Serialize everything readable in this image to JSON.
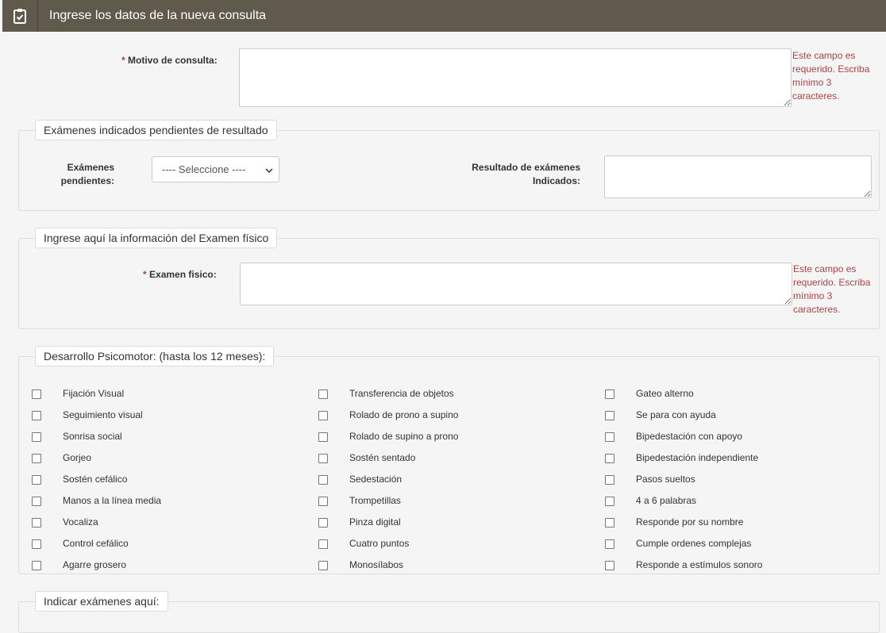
{
  "header": {
    "title": "Ingrese los datos de la nueva consulta"
  },
  "motivo": {
    "required_mark": "*",
    "label": "Motivo de consulta:",
    "error": [
      "Este campo es",
      "requerido. Escriba",
      "mínimo 3",
      "caracteres."
    ]
  },
  "examenes": {
    "legend": "Exámenes indicados pendientes de resultado",
    "pendientes_label": [
      "Exámenes",
      "pendientes:"
    ],
    "select_value": "---- Seleccione ----",
    "resultado_label": [
      "Resultado de exámenes",
      "Indicados:"
    ]
  },
  "fisico": {
    "legend": "Ingrese aquí la información del Examen físico",
    "required_mark": "*",
    "label": "Examen fisico:",
    "error": [
      "Este campo es",
      "requerido. Escriba",
      "mínimo 3",
      "caracteres."
    ]
  },
  "psicomotor": {
    "legend": "Desarrollo Psicomotor: (hasta los 12 meses):",
    "columns": [
      [
        "Fijación Visual",
        "Seguimiento visual",
        "Sonrisa social",
        "Gorjeo",
        "Sostén cefálico",
        "Manos a la línea media",
        "Vocaliza",
        "Control cefálico",
        "Agarre grosero"
      ],
      [
        "Transferencia de objetos",
        "Rolado de prono a supino",
        "Rolado de supino a prono",
        "Sostén sentado",
        "Sedestación",
        "Trompetillas",
        "Pinza digital",
        "Cuatro puntos",
        "Monosílabos"
      ],
      [
        "Gateo alterno",
        "Se para con ayuda",
        "Bipedestación con apoyo",
        "Bipedestación independiente",
        "Pasos sueltos",
        "4 a 6 palabras",
        "Responde por su nombre",
        "Cumple ordenes complejas",
        "Responde a estímulos sonoro"
      ]
    ]
  },
  "indicar": {
    "legend": "Indicar exámenes aquí:"
  }
}
